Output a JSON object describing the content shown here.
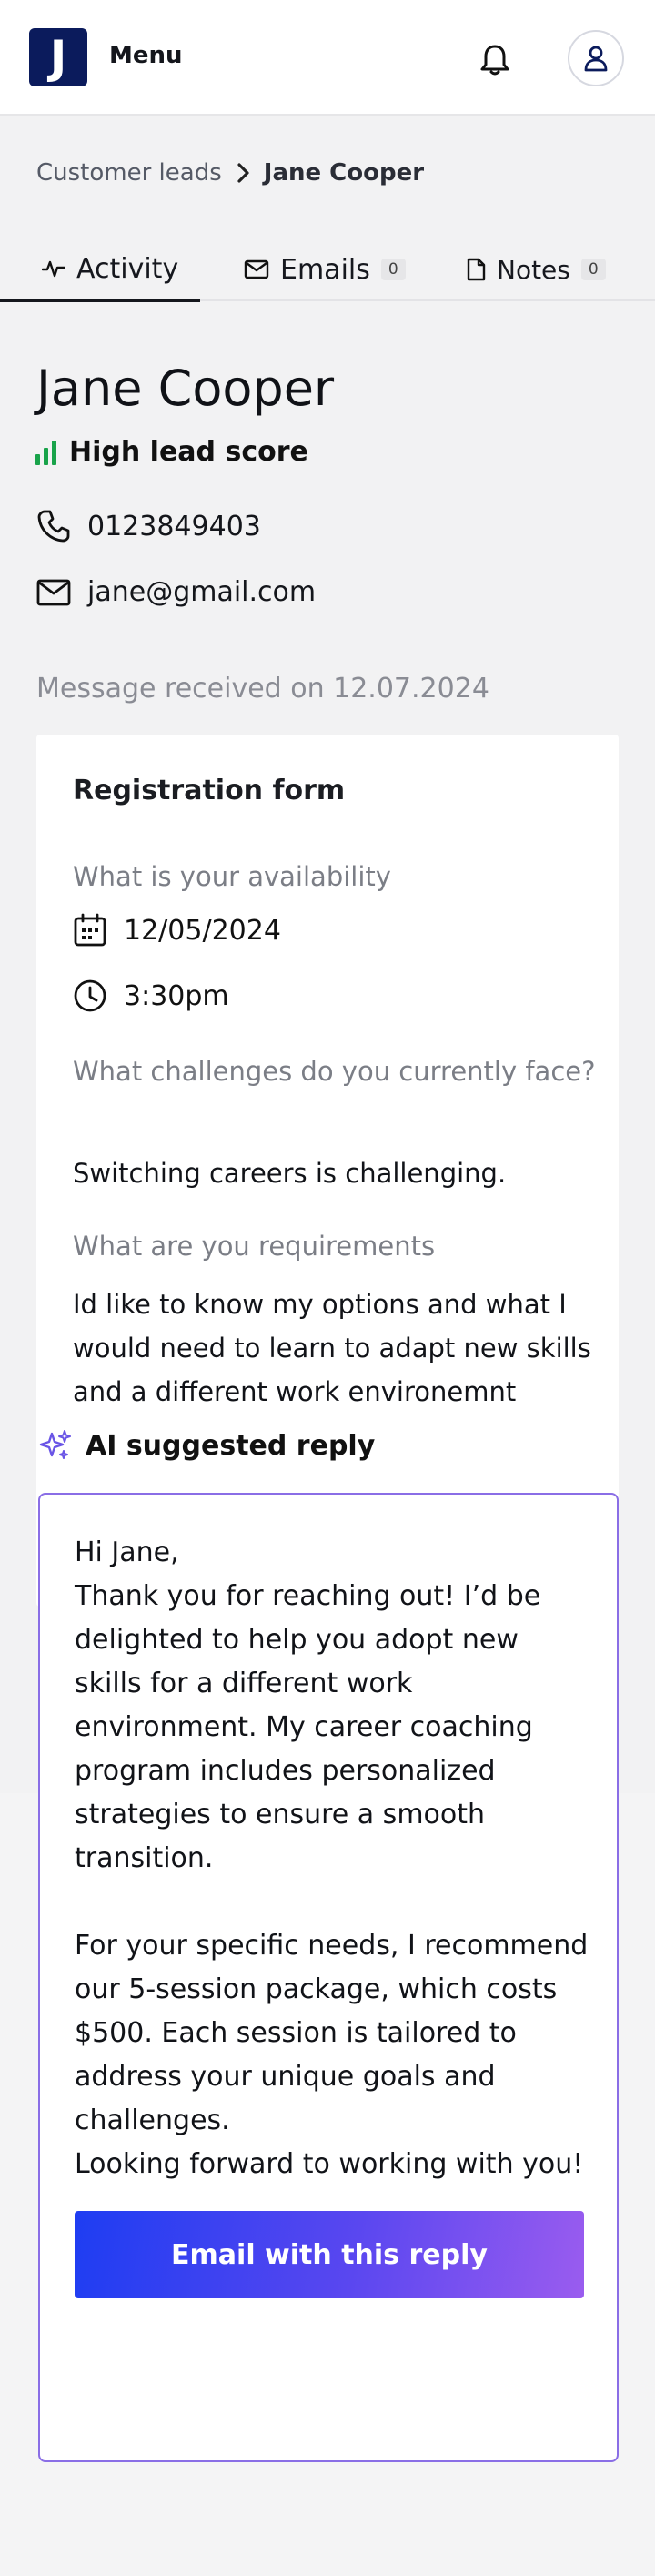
{
  "header": {
    "logo_letter": "J",
    "menu_label": "Menu",
    "bell_icon": "bell-icon",
    "account_icon": "user-icon"
  },
  "breadcrumb": {
    "parent": "Customer leads",
    "current": "Jane Cooper"
  },
  "tabs": [
    {
      "label": "Activity",
      "icon": "activity-icon",
      "active": true
    },
    {
      "label": "Emails",
      "icon": "mail-icon",
      "count": "0"
    },
    {
      "label": "Notes",
      "icon": "note-icon",
      "count": "0"
    }
  ],
  "lead": {
    "name": "Jane Cooper",
    "score_label": "High lead score",
    "phone": "0123849403",
    "email": "jane@gmail.com",
    "received": "Message received on 12.07.2024"
  },
  "form": {
    "title": "Registration form",
    "availability_question": "What is your availability",
    "date": "12/05/2024",
    "time": "3:30pm",
    "challenges_question": "What challenges do you currently face?",
    "challenges_answer": "Switching careers is challenging.",
    "requirements_question": "What are you requirements",
    "requirements_answer": "Id like to know my options and what I would need to learn to adapt new skills and a different work environemnt"
  },
  "ai": {
    "heading": "AI suggested reply",
    "greeting": "Hi Jane,",
    "paragraph1": "Thank you for reaching out! I’d be delighted to help you adopt new skills for a different work environment. My career coaching program includes personalized strategies to ensure a smooth transition.",
    "paragraph2": "For your specific needs, I recommend our 5-session package, which costs $500. Each session is tailored to address your unique goals and challenges.",
    "closing": "Looking forward to working with you!",
    "button_label": "Email with this reply"
  },
  "colors": {
    "brand": "#0b1b5c",
    "score_green": "#19a34a",
    "ai_accent": "#8a6ee6",
    "button_start": "#1e3df2",
    "button_end": "#9a5cef"
  }
}
